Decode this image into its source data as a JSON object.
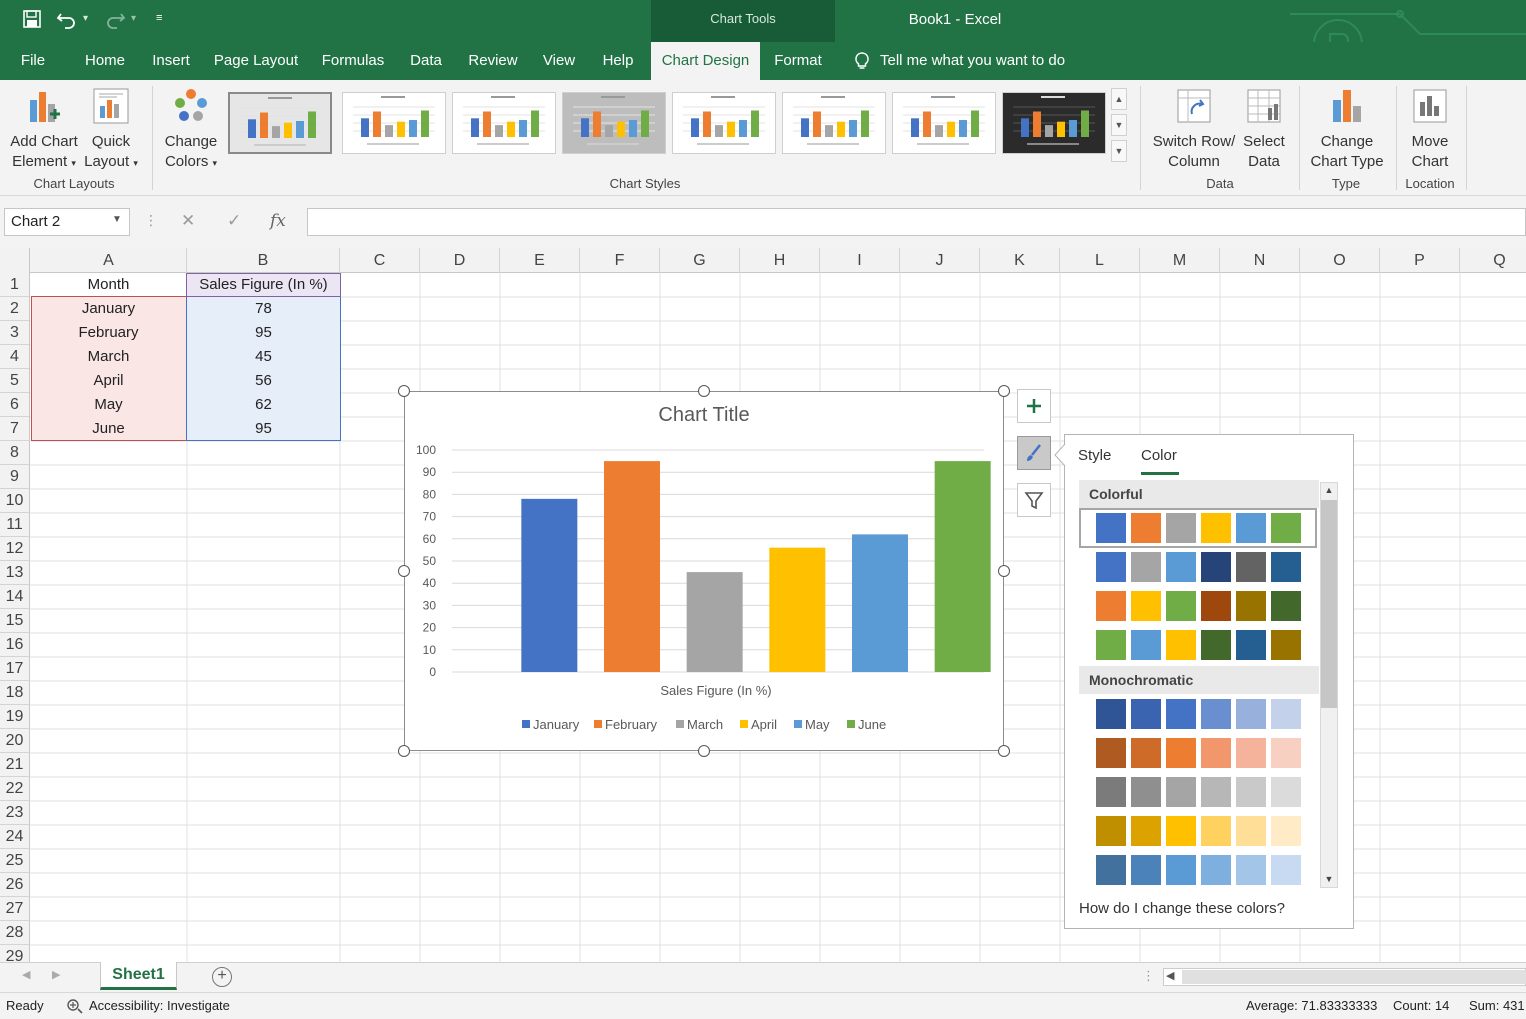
{
  "qat": {
    "save_icon": "save-icon",
    "undo_icon": "undo-icon",
    "redo_icon": "redo-icon",
    "customize_icon": "customize-qat-icon"
  },
  "title_bar": {
    "context_tools": "Chart Tools",
    "window_title": "Book1  -  Excel"
  },
  "tabs": [
    "File",
    "Home",
    "Insert",
    "Page Layout",
    "Formulas",
    "Data",
    "Review",
    "View",
    "Help",
    "Chart Design",
    "Format"
  ],
  "active_tab": "Chart Design",
  "tell_me": "Tell me what you want to do",
  "ribbon": {
    "add_chart_element": [
      "Add Chart",
      "Element"
    ],
    "quick_layout": [
      "Quick",
      "Layout"
    ],
    "change_colors": [
      "Change",
      "Colors"
    ],
    "switch_row_col": [
      "Switch Row/",
      "Column"
    ],
    "select_data": [
      "Select",
      "Data"
    ],
    "change_chart_type": [
      "Change",
      "Chart Type"
    ],
    "move_chart": [
      "Move",
      "Chart"
    ],
    "groups": {
      "chart_layouts": "Chart Layouts",
      "chart_styles": "Chart Styles",
      "data": "Data",
      "type": "Type",
      "location": "Location"
    }
  },
  "formula_bar": {
    "name_box": "Chart 2",
    "value": ""
  },
  "columns": [
    "A",
    "B",
    "C",
    "D",
    "E",
    "F",
    "G",
    "H",
    "I",
    "J",
    "K",
    "L",
    "M",
    "N",
    "O",
    "P",
    "Q"
  ],
  "rows": [
    "1",
    "2",
    "3",
    "4",
    "5",
    "6",
    "7",
    "8",
    "9",
    "10",
    "11",
    "12",
    "13",
    "14",
    "15",
    "16",
    "17",
    "18",
    "19",
    "20",
    "21",
    "22",
    "23",
    "24",
    "25",
    "26",
    "27",
    "28",
    "29"
  ],
  "sheet": {
    "header": [
      "Month",
      "Sales Figure (In %)"
    ],
    "data": [
      [
        "January",
        "78"
      ],
      [
        "February",
        "95"
      ],
      [
        "March",
        "45"
      ],
      [
        "April",
        "56"
      ],
      [
        "May",
        "62"
      ],
      [
        "June",
        "95"
      ]
    ]
  },
  "chart_data": {
    "type": "bar",
    "title": "Chart Title",
    "xlabel": "Sales Figure (In %)",
    "ylabel": "",
    "ylim": [
      0,
      100
    ],
    "yticks": [
      0,
      10,
      20,
      30,
      40,
      50,
      60,
      70,
      80,
      90,
      100
    ],
    "categories": [
      "January",
      "February",
      "March",
      "April",
      "May",
      "June"
    ],
    "values": [
      78,
      95,
      45,
      56,
      62,
      95
    ],
    "colors": [
      "#4472c4",
      "#ed7d31",
      "#a5a5a5",
      "#ffc000",
      "#5b9bd5",
      "#70ad47"
    ],
    "grid": true,
    "legend": "bottom"
  },
  "chart_buttons": {
    "elements_icon": "plus-icon",
    "styles_icon": "brush-icon",
    "filters_icon": "filter-icon"
  },
  "color_panel": {
    "tabs": [
      "Style",
      "Color"
    ],
    "active_tab": "Color",
    "colorful_label": "Colorful",
    "monochromatic_label": "Monochromatic",
    "colorful": [
      [
        "#4472c4",
        "#ed7d31",
        "#a5a5a5",
        "#ffc000",
        "#5b9bd5",
        "#70ad47"
      ],
      [
        "#4472c4",
        "#a5a5a5",
        "#5b9bd5",
        "#264478",
        "#636363",
        "#255e91"
      ],
      [
        "#ed7d31",
        "#ffc000",
        "#70ad47",
        "#9e480e",
        "#997300",
        "#43682b"
      ],
      [
        "#70ad47",
        "#5b9bd5",
        "#ffc000",
        "#43682b",
        "#255e91",
        "#997300"
      ]
    ],
    "monochromatic": [
      [
        "#2f5597",
        "#3a64b0",
        "#4472c4",
        "#6a8fd0",
        "#97b1dc",
        "#c3d1eb"
      ],
      [
        "#ae5a21",
        "#cf6b28",
        "#ed7d31",
        "#f1976b",
        "#f4b39a",
        "#f8d0c1"
      ],
      [
        "#7b7b7b",
        "#8f8f8f",
        "#a5a5a5",
        "#b7b7b7",
        "#c9c9c9",
        "#dbdbdb"
      ],
      [
        "#bf8f00",
        "#dca200",
        "#ffc000",
        "#ffd15f",
        "#ffdf97",
        "#ffebc6"
      ],
      [
        "#41719c",
        "#4a82b9",
        "#5b9bd5",
        "#7eb0df",
        "#a3c5e8",
        "#c7daf1"
      ]
    ],
    "help": "How do I change these colors?"
  },
  "sheet_tabs": {
    "active": "Sheet1"
  },
  "status": {
    "ready": "Ready",
    "accessibility": "Accessibility: Investigate",
    "average": "Average: 71.83333333",
    "count": "Count: 14",
    "sum": "Sum: 431"
  }
}
